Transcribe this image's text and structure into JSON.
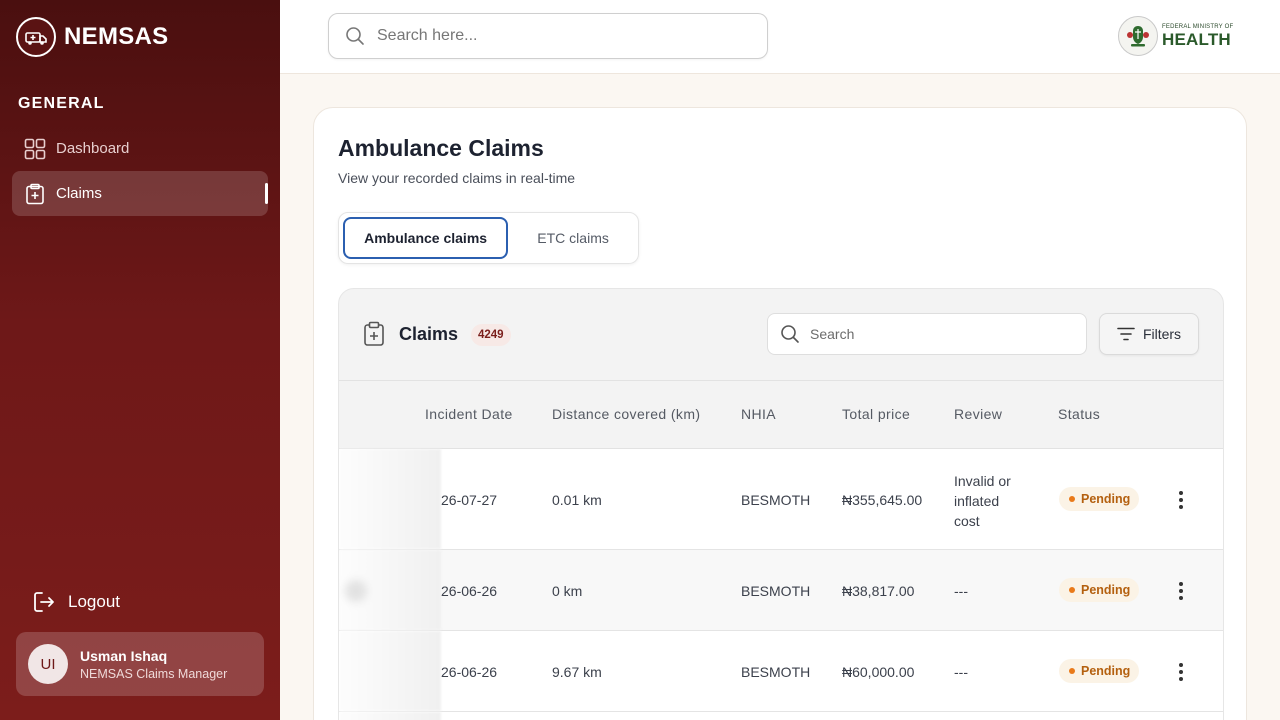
{
  "brand": {
    "name": "NEMSAS"
  },
  "sidebar": {
    "section_label": "GENERAL",
    "items": [
      {
        "label": "Dashboard",
        "icon": "grid-icon",
        "active": false
      },
      {
        "label": "Claims",
        "icon": "clipboard-plus-icon",
        "active": true
      }
    ],
    "logout_label": "Logout",
    "user": {
      "initials": "UI",
      "name": "Usman Ishaq",
      "role": "NEMSAS Claims Manager"
    }
  },
  "topbar": {
    "search_placeholder": "Search here...",
    "ministry_small": "FEDERAL MINISTRY OF",
    "ministry_big": "HEALTH"
  },
  "page": {
    "title": "Ambulance Claims",
    "subtitle": "View your recorded claims in real-time",
    "tabs": [
      {
        "label": "Ambulance claims",
        "active": true
      },
      {
        "label": "ETC claims",
        "active": false
      }
    ]
  },
  "claims_panel": {
    "title": "Claims",
    "count": "4249",
    "search_placeholder": "Search",
    "filters_label": "Filters",
    "columns": [
      "Incident Date",
      "Distance covered (km)",
      "NHIA",
      "Total price",
      "Review",
      "Status"
    ],
    "rows": [
      {
        "date": "26-07-27",
        "distance": "0.01 km",
        "nhia": "BESMOTH",
        "price": "₦355,645.00",
        "review": [
          "Invalid or",
          "inflated",
          "cost"
        ],
        "status": "Pending"
      },
      {
        "date": "26-06-26",
        "distance": "0 km",
        "nhia": "BESMOTH",
        "price": "₦38,817.00",
        "review": [
          "---"
        ],
        "status": "Pending"
      },
      {
        "date": "26-06-26",
        "distance": "9.67 km",
        "nhia": "BESMOTH",
        "price": "₦60,000.00",
        "review": [
          "---"
        ],
        "status": "Pending"
      }
    ]
  },
  "colors": {
    "sidebar_top": "#4a0f0f",
    "sidebar_bottom": "#7c1d1b",
    "tab_active_border": "#2b5fb0",
    "status_pending": "#b4600f"
  }
}
